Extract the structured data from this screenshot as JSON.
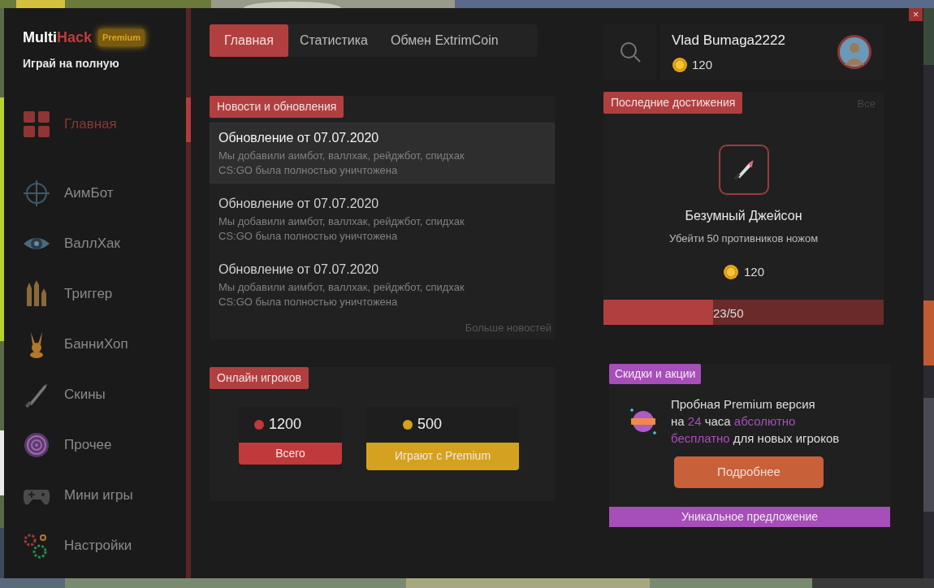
{
  "window": {
    "close_button": "×"
  },
  "brand": {
    "name_first": "Multi",
    "name_second": "Hack",
    "badge": "Premium",
    "tagline": "Играй на полную"
  },
  "sidebar": {
    "items": [
      {
        "label": "Главная",
        "kind": "grid",
        "selected": true
      },
      {
        "label": "АимБот",
        "kind": "crosshair",
        "selected": false
      },
      {
        "label": "ВаллХак",
        "kind": "eye",
        "selected": false
      },
      {
        "label": "Триггер",
        "kind": "bullets",
        "selected": false
      },
      {
        "label": "БанниХоп",
        "kind": "rabbit",
        "selected": false
      },
      {
        "label": "Скины",
        "kind": "knife",
        "selected": false
      },
      {
        "label": "Прочее",
        "kind": "spiral",
        "selected": false
      },
      {
        "label": "Мини игры",
        "kind": "gamepad",
        "selected": false
      },
      {
        "label": "Настройки",
        "kind": "gears",
        "selected": false
      }
    ]
  },
  "tabs": [
    {
      "label": "Главная",
      "selected": true
    },
    {
      "label": "Статистика",
      "selected": false
    },
    {
      "label": "Обмен ExtrimCoin",
      "selected": false
    }
  ],
  "news": {
    "title": "Новости и обновления",
    "items": [
      {
        "title": "Обновление от 07.07.2020",
        "lines": [
          "Мы добавили аимбот, валлхак, рейджбот, спидхак",
          "CS:GO была полностью уничтожена"
        ],
        "selected": true
      },
      {
        "title": "Обновление от 07.07.2020",
        "lines": [
          "Мы добавили аимбот, валлхак, рейджбот, спидхак",
          "CS:GO была полностью уничтожена"
        ],
        "selected": false
      },
      {
        "title": "Обновление от 07.07.2020",
        "lines": [
          "Мы добавили аимбот, валлхак, рейджбот, спидхак",
          "CS:GO была полностью уничтожена"
        ],
        "selected": false
      }
    ],
    "more": "Больше новостей"
  },
  "online": {
    "title": "Онлайн игроков",
    "stats": [
      {
        "value": "1200",
        "label": "Всего",
        "color": "#c0393b"
      },
      {
        "value": "500",
        "label": "Играют с Premium",
        "color": "#d4a21f"
      }
    ]
  },
  "profile": {
    "name": "Vlad Bumaga2222",
    "coins": "120"
  },
  "achievements": {
    "title": "Последние достижения",
    "all_link": "Все",
    "item": {
      "name": "Безумный Джейсон",
      "description": "Убейти 50 противников ножом",
      "reward": "120",
      "progress_text": "23/50",
      "level": 0.39
    }
  },
  "promo": {
    "title": "Скидки и акции",
    "lines": [
      [
        {
          "text": "Пробная Premium версия",
          "highlight": false
        }
      ],
      [
        {
          "text": "на ",
          "highlight": false
        },
        {
          "text": "24",
          "highlight": true
        },
        {
          "text": " часа ",
          "highlight": false
        },
        {
          "text": "абсолютно",
          "highlight": true
        }
      ],
      [
        {
          "text": "бесплатно",
          "highlight": true
        },
        {
          "text": " для новых игроков",
          "highlight": false
        }
      ]
    ],
    "button": "Подробнее",
    "footer": "Уникальное предложение"
  }
}
